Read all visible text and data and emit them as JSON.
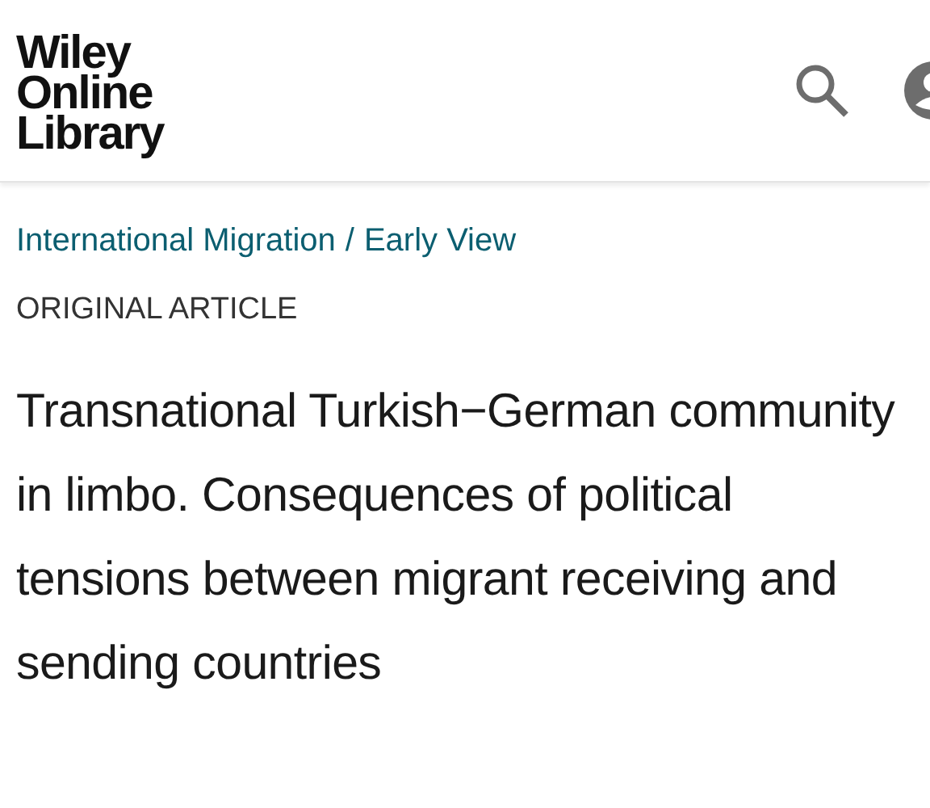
{
  "header": {
    "logo": [
      "Wiley",
      "Online",
      "Library"
    ]
  },
  "breadcrumb": {
    "items": [
      "International Migration",
      "Early View"
    ],
    "separator": "/"
  },
  "article": {
    "type_label": "ORIGINAL ARTICLE",
    "title": "Transnational Turkish−German community in limbo. Consequences of political tensions between migrant receiving and sending countries"
  }
}
